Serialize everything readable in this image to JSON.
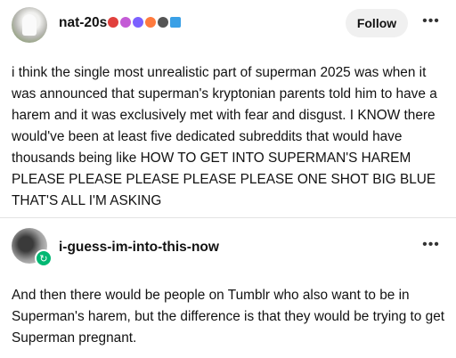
{
  "post": {
    "username": "nat-20s",
    "follow_label": "Follow",
    "more_label": "•••",
    "badges": [
      {
        "icon": "badge-icon",
        "color": "#e1403d"
      },
      {
        "icon": "badge-icon",
        "color": "#c45bd6"
      },
      {
        "icon": "badge-icon",
        "color": "#7b61ff"
      },
      {
        "icon": "badge-icon",
        "color": "#ff7a3d"
      },
      {
        "icon": "badge-icon",
        "color": "#555555"
      },
      {
        "icon": "badge-icon",
        "color": "#3aa0e6"
      }
    ],
    "text": "i think the single most unrealistic part of superman 2025 was when it was announced that superman's kryptonian parents told him to have a harem and it was exclusively met with fear and disgust. I KNOW there would've been at least five dedicated subreddits that would have thousands being like HOW TO GET INTO SUPERMAN'S HAREM PLEASE PLEASE PLEASE PLEASE PLEASE ONE SHOT BIG BLUE THAT'S ALL I'M ASKING"
  },
  "reblog": {
    "username": "i-guess-im-into-this-now",
    "more_label": "•••",
    "text": "And then there would be people on Tumblr who also want to be in Superman's harem, but the difference is that they would be trying to get Superman pregnant."
  },
  "colors": {
    "accent_green": "#00b873",
    "follow_bg": "#f0f0f0"
  }
}
